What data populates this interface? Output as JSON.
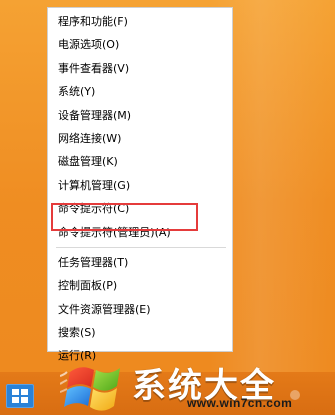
{
  "menu": {
    "groups": [
      [
        {
          "label": "程序和功能(F)"
        },
        {
          "label": "电源选项(O)"
        },
        {
          "label": "事件查看器(V)"
        },
        {
          "label": "系统(Y)"
        },
        {
          "label": "设备管理器(M)"
        },
        {
          "label": "网络连接(W)"
        },
        {
          "label": "磁盘管理(K)"
        },
        {
          "label": "计算机管理(G)"
        },
        {
          "label": "命令提示符(C)"
        },
        {
          "label": "命令提示符(管理员)(A)"
        }
      ],
      [
        {
          "label": "任务管理器(T)"
        },
        {
          "label": "控制面板(P)"
        },
        {
          "label": "文件资源管理器(E)"
        },
        {
          "label": "搜索(S)"
        },
        {
          "label": "运行(R)"
        }
      ]
    ]
  },
  "watermark": {
    "title": "系统大全",
    "url": "www.win7cn.com"
  },
  "colors": {
    "desktop": "#f39a2a",
    "highlight": "#e53b3b",
    "start": "#2a82d8"
  },
  "icons": {
    "start": "windows-logo-icon",
    "brand": "windows-flag-icon"
  }
}
